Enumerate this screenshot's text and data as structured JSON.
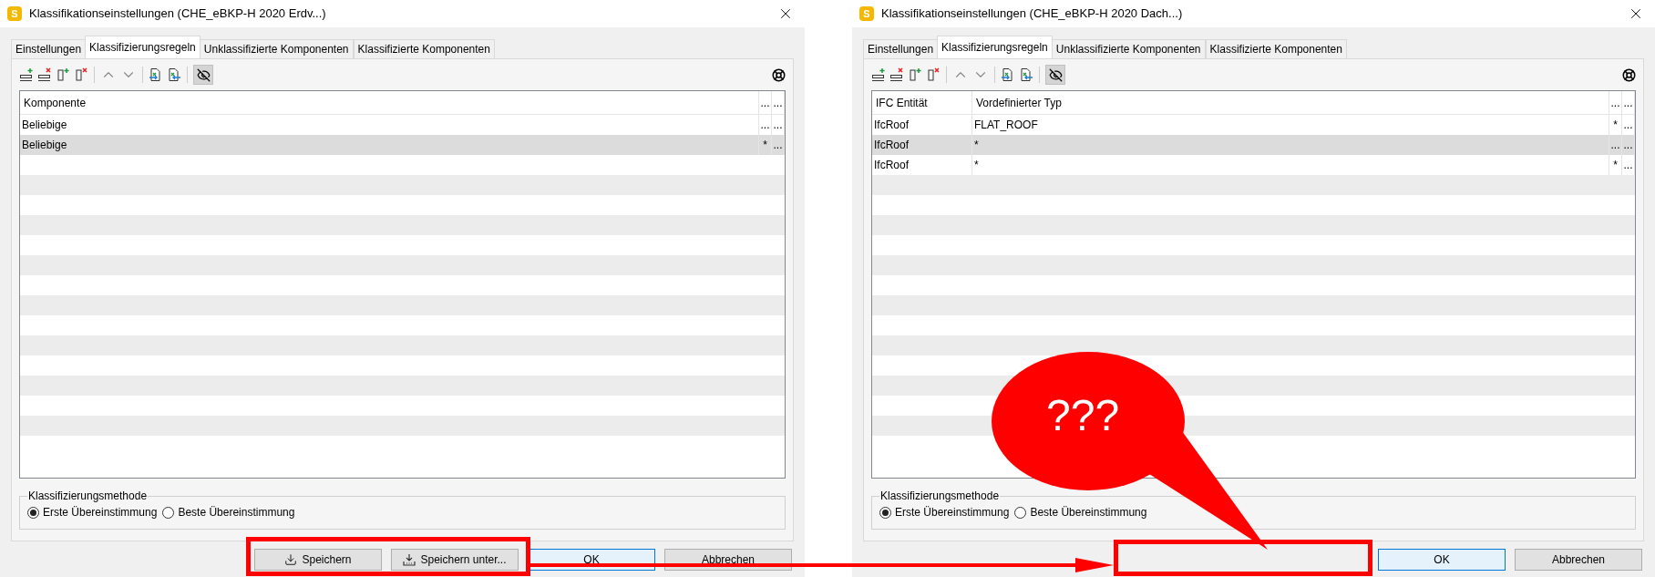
{
  "dialogs": [
    {
      "app_icon": "S",
      "title": "Klassifikationseinstellungen (CHE_eBKP-H 2020 Erdv...)",
      "tabs": [
        {
          "label": "Einstellungen",
          "selected": false
        },
        {
          "label": "Klassifizierungsregeln",
          "selected": true
        },
        {
          "label": "Unklassifizierte Komponenten",
          "selected": false
        },
        {
          "label": "Klassifizierte Komponenten",
          "selected": false
        }
      ],
      "visibility_toggle_on": true,
      "columns": [
        {
          "label": "Komponente",
          "kind": "fill"
        },
        {
          "label": "...",
          "kind": "narrow"
        },
        {
          "label": "...",
          "kind": "narrow"
        }
      ],
      "rows": [
        {
          "cells": [
            "Beliebige",
            "...",
            "..."
          ],
          "selected": false
        },
        {
          "cells": [
            "Beliebige",
            "*",
            "..."
          ],
          "selected": true
        }
      ],
      "method": {
        "title": "Klassifizierungsmethode",
        "options": [
          {
            "label": "Erste Übereinstimmung",
            "selected": true
          },
          {
            "label": "Beste Übereinstimmung",
            "selected": false
          }
        ]
      },
      "buttons": [
        {
          "label": "Speichern",
          "kind": "save"
        },
        {
          "label": "Speichern unter...",
          "kind": "save-as"
        },
        {
          "label": "OK",
          "kind": "default"
        },
        {
          "label": "Abbrechen",
          "kind": "plain"
        }
      ]
    },
    {
      "app_icon": "S",
      "title": "Klassifikationseinstellungen (CHE_eBKP-H 2020 Dach...)",
      "tabs": [
        {
          "label": "Einstellungen",
          "selected": false
        },
        {
          "label": "Klassifizierungsregeln",
          "selected": true
        },
        {
          "label": "Unklassifizierte Komponenten",
          "selected": false
        },
        {
          "label": "Klassifizierte Komponenten",
          "selected": false
        }
      ],
      "visibility_toggle_on": true,
      "columns": [
        {
          "label": "IFC Entität",
          "kind": "fixed"
        },
        {
          "label": "Vordefinierter Typ",
          "kind": "fill"
        },
        {
          "label": "...",
          "kind": "narrow"
        },
        {
          "label": "...",
          "kind": "narrow"
        }
      ],
      "rows": [
        {
          "cells": [
            "IfcRoof",
            "FLAT_ROOF",
            "*",
            "..."
          ],
          "selected": false
        },
        {
          "cells": [
            "IfcRoof",
            "*",
            "...",
            "..."
          ],
          "selected": true
        },
        {
          "cells": [
            "IfcRoof",
            "*",
            "*",
            "..."
          ],
          "selected": false
        }
      ],
      "method": {
        "title": "Klassifizierungsmethode",
        "options": [
          {
            "label": "Erste Übereinstimmung",
            "selected": true
          },
          {
            "label": "Beste Übereinstimmung",
            "selected": false
          }
        ]
      },
      "buttons": [
        {
          "label": "OK",
          "kind": "default"
        },
        {
          "label": "Abbrechen",
          "kind": "plain"
        }
      ]
    }
  ],
  "annotation": {
    "callout_text": "???"
  }
}
